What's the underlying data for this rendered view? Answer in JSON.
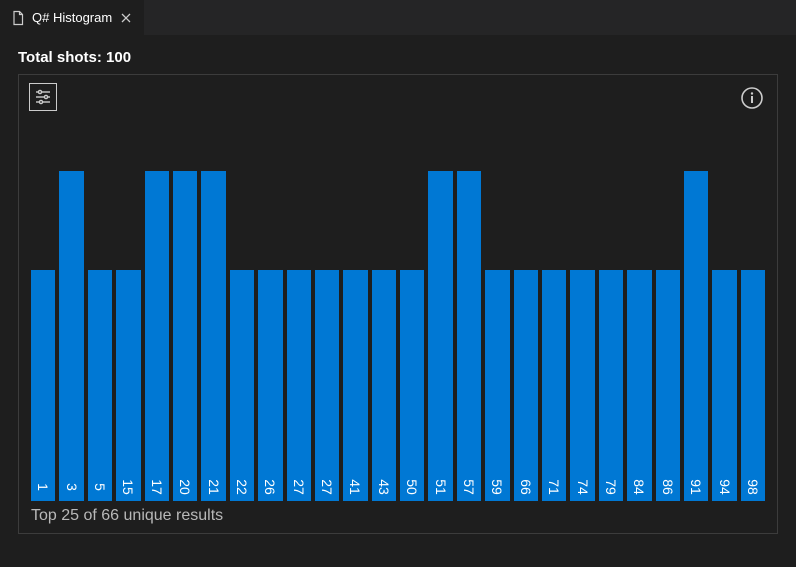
{
  "tab": {
    "title": "Q# Histogram"
  },
  "header": {
    "shots_label": "Total shots: 100"
  },
  "caption": "Top 25 of 66 unique results",
  "colors": {
    "bar": "#0078d4"
  },
  "chart_data": {
    "type": "bar",
    "title": "Q# Histogram",
    "xlabel": "",
    "ylabel": "",
    "ylim": [
      0,
      2
    ],
    "categories": [
      "1",
      "3",
      "5",
      "15",
      "17",
      "20",
      "21",
      "22",
      "26",
      "27",
      "27",
      "41",
      "43",
      "50",
      "51",
      "57",
      "59",
      "66",
      "71",
      "74",
      "79",
      "84",
      "86",
      "91",
      "94",
      "98"
    ],
    "values": [
      1.4,
      2,
      1.4,
      1.4,
      2,
      2,
      2,
      1.4,
      1.4,
      1.4,
      1.4,
      1.4,
      1.4,
      1.4,
      2,
      2,
      1.4,
      1.4,
      1.4,
      1.4,
      1.4,
      1.4,
      1.4,
      2,
      1.4,
      1.4
    ]
  }
}
